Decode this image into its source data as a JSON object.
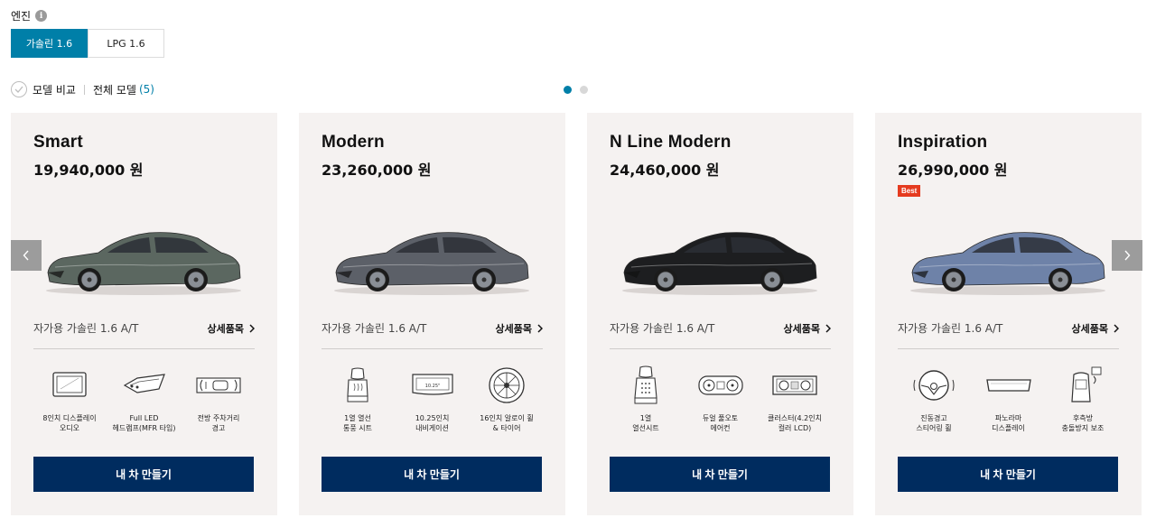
{
  "engine": {
    "label": "엔진",
    "tabs": [
      {
        "label": "가솔린 1.6",
        "active": true
      },
      {
        "label": "LPG 1.6",
        "active": false
      }
    ]
  },
  "compare": {
    "label": "모델 비교",
    "all_models_label": "전체 모델",
    "all_models_count": "(5)"
  },
  "pagination": {
    "pages": 2,
    "current": 1
  },
  "models": [
    {
      "name": "Smart",
      "price": "19,940,000 원",
      "badge": "",
      "color": "#5b6760",
      "trim": "자가용 가솔린 1.6 A/T",
      "detail_label": "상세품목",
      "features": [
        {
          "icon": "display-icon",
          "text": "8인치 디스플레이\n오디오"
        },
        {
          "icon": "headlamp-icon",
          "text": "Full LED\n헤드램프(MFR 타입)"
        },
        {
          "icon": "parking-sensor-icon",
          "text": "전방 주차거리\n경고"
        }
      ],
      "button_label": "내 차 만들기"
    },
    {
      "name": "Modern",
      "price": "23,260,000 원",
      "badge": "",
      "color": "#5c6068",
      "trim": "자가용 가솔린 1.6 A/T",
      "detail_label": "상세품목",
      "features": [
        {
          "icon": "heated-seat-icon",
          "text": "1열 열선\n통풍 시트"
        },
        {
          "icon": "navigation-icon",
          "text": "10.25인치\n내비게이션"
        },
        {
          "icon": "alloy-wheel-icon",
          "text": "16인치 알로이 휠\n& 타이어"
        }
      ],
      "button_label": "내 차 만들기"
    },
    {
      "name": "N Line Modern",
      "price": "24,460,000 원",
      "badge": "",
      "color": "#1d1e20",
      "trim": "자가용 가솔린 1.6 A/T",
      "detail_label": "상세품목",
      "features": [
        {
          "icon": "heated-seat-icon",
          "text": "1열\n열선시트"
        },
        {
          "icon": "climate-control-icon",
          "text": "듀얼 풀오토\n에어컨"
        },
        {
          "icon": "cluster-icon",
          "text": "클러스터(4.2인치\n컬러 LCD)"
        }
      ],
      "button_label": "내 차 만들기"
    },
    {
      "name": "Inspiration",
      "price": "26,990,000 원",
      "badge": "Best",
      "color": "#6e82a8",
      "trim": "자가용 가솔린 1.6 A/T",
      "detail_label": "상세품목",
      "features": [
        {
          "icon": "steering-wheel-icon",
          "text": "진동경고\n스티어링 휠"
        },
        {
          "icon": "panorama-display-icon",
          "text": "파노라마\n디스플레이"
        },
        {
          "icon": "rear-collision-icon",
          "text": "후측방\n충돌방지 보조"
        }
      ],
      "button_label": "내 차 만들기"
    }
  ]
}
